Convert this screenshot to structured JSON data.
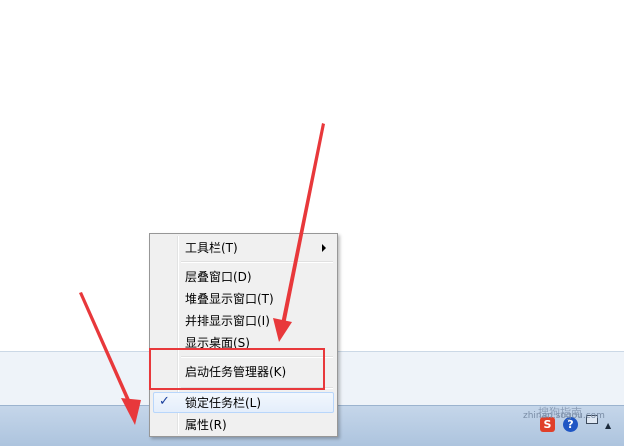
{
  "context_menu": {
    "items": [
      {
        "label": "工具栏(T)"
      },
      {
        "label": "层叠窗口(D)"
      },
      {
        "label": "堆叠显示窗口(T)"
      },
      {
        "label": "并排显示窗口(I)"
      },
      {
        "label": "显示桌面(S)"
      },
      {
        "label": "启动任务管理器(K)"
      },
      {
        "label": "锁定任务栏(L)"
      },
      {
        "label": "属性(R)"
      }
    ],
    "check_glyph": "✓"
  },
  "tray": {
    "icons": [
      "sogou-s-icon",
      "help-icon",
      "network-icon",
      "show-hidden-icons-icon"
    ],
    "sogou_glyph": "S",
    "help_glyph": "?",
    "up_glyph": "▲",
    "watermark_url": "zhinan.sogou.com",
    "watermark_text": "搜狗指南"
  },
  "colors": {
    "highlight": "#e8383b",
    "taskbar": "#b9cde5",
    "menu_bg": "#f0f0f0"
  }
}
